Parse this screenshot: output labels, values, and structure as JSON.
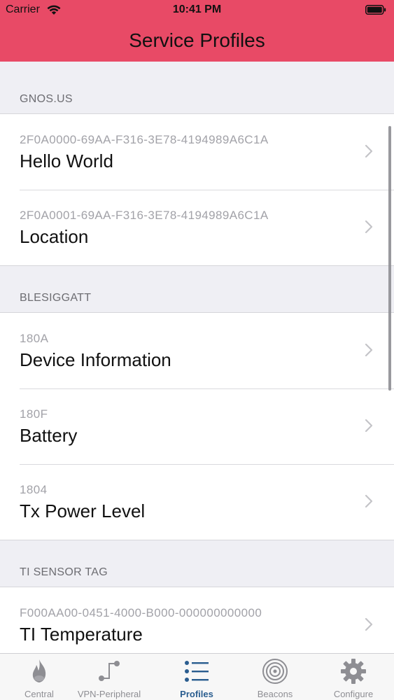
{
  "status_bar": {
    "carrier": "Carrier",
    "time": "10:41 PM"
  },
  "nav": {
    "title": "Service Profiles",
    "bar_color": "#e84a66"
  },
  "sections": [
    {
      "title": "GNOS.US",
      "rows": [
        {
          "uuid": "2F0A0000-69AA-F316-3E78-4194989A6C1A",
          "name": "Hello World"
        },
        {
          "uuid": "2F0A0001-69AA-F316-3E78-4194989A6C1A",
          "name": "Location"
        }
      ]
    },
    {
      "title": "BLESIGGATT",
      "rows": [
        {
          "uuid": "180A",
          "name": "Device Information"
        },
        {
          "uuid": "180F",
          "name": "Battery"
        },
        {
          "uuid": "1804",
          "name": "Tx Power Level"
        }
      ]
    },
    {
      "title": "TI SENSOR TAG",
      "rows": [
        {
          "uuid": "F000AA00-0451-4000-B000-000000000000",
          "name": "TI Temperature"
        }
      ]
    }
  ],
  "tabbar": {
    "active_color": "#2a5d8f",
    "inactive_color": "#8e8e93",
    "tabs": [
      {
        "label": "Central",
        "icon": "flame-icon",
        "active": false
      },
      {
        "label": "VPN-Peripheral",
        "icon": "peripheral-connector-icon",
        "active": false
      },
      {
        "label": "Profiles",
        "icon": "list-icon",
        "active": true
      },
      {
        "label": "Beacons",
        "icon": "beacon-target-icon",
        "active": false
      },
      {
        "label": "Configure",
        "icon": "gear-icon",
        "active": false
      }
    ]
  }
}
